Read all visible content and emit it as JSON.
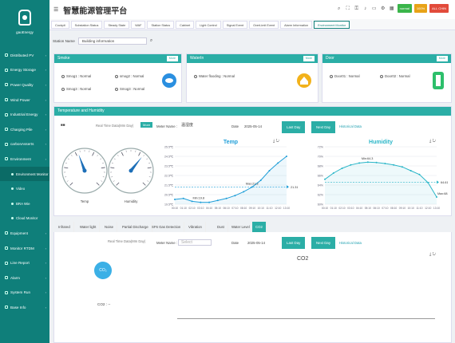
{
  "app": {
    "title": "智慧能源管理平台",
    "user": "gaoEnergy"
  },
  "sidebar": {
    "items": [
      {
        "label": "Distributed PV"
      },
      {
        "label": "Energy Storage"
      },
      {
        "label": "Power Quality"
      },
      {
        "label": "Wind Power"
      },
      {
        "label": "Industrial Energy"
      },
      {
        "label": "Charging Pile"
      },
      {
        "label": "carbonAsserts"
      },
      {
        "label": "Environment"
      },
      {
        "label": "Environment Monitor"
      },
      {
        "label": "Video"
      },
      {
        "label": "BRA Wie"
      },
      {
        "label": "Cloud Monitor"
      },
      {
        "label": "Equipment"
      },
      {
        "label": "Monitor RTDM"
      },
      {
        "label": "Line Report"
      },
      {
        "label": "Alarm"
      },
      {
        "label": "System Run"
      },
      {
        "label": "Base Info"
      }
    ]
  },
  "header": {
    "badges": [
      "normal",
      "100%",
      "ALL CHIN"
    ],
    "badge_colors": [
      "#3ab54a",
      "#e8a317",
      "#e24b3b"
    ]
  },
  "tabs": [
    "Cockpit",
    "Substation Status",
    "Steady State",
    "WAF",
    "Station Status",
    "Cabinet",
    "Light Control",
    "Signal Event",
    "OverLimit Event",
    "Alarm Information",
    "Environment Monitor"
  ],
  "filter": {
    "label": "Station Name",
    "value": "Building information"
  },
  "smoke": {
    "title": "Smoke",
    "more": "More",
    "items": [
      "Smog1 : Normal",
      "smog2 : Normal",
      "Smog3 : Normal",
      "Smog3 : Normal"
    ]
  },
  "waterin": {
    "title": "WaterIn",
    "more": "More",
    "items": [
      "Water flooding : Normal"
    ]
  },
  "door": {
    "title": "Door",
    "more": "More",
    "items": [
      "Door01 : Normal",
      "Door02 : Normal"
    ]
  },
  "th": {
    "title": "Temperature and Humidity",
    "tabs": [
      "Real Time Data(Mm Day)",
      "More"
    ],
    "meter_label": "Meter Name :",
    "meter_value": "温湿度",
    "date_label": "Date",
    "date": "2025-05-14",
    "last_day": "Last Day",
    "next_day": "Next Day",
    "hist": "Historical Data",
    "gauges": [
      {
        "label": "Temp",
        "value": 21.3,
        "max": 50
      },
      {
        "label": "Humidity",
        "value": 64.3,
        "max": 100
      }
    ]
  },
  "chart_data": [
    {
      "type": "line",
      "title": "Temp",
      "x": [
        "00:10",
        "01:10",
        "02:10",
        "03:10",
        "04:10",
        "05:10",
        "06:10",
        "07:10",
        "08:10",
        "09:10",
        "10:10",
        "11:10",
        "12:10",
        "13:10"
      ],
      "ylabels": [
        "25.5℃",
        "24.5℃",
        "23.5℃",
        "22.5℃",
        "21.5℃",
        "20.5℃",
        "19.5℃"
      ],
      "ylim": [
        19.5,
        25.5
      ],
      "values": [
        20.0,
        20.1,
        19.8,
        19.7,
        19.7,
        19.9,
        20.1,
        20.4,
        20.8,
        21.3,
        22.0,
        23.0,
        23.8,
        24.5
      ],
      "annotations": [
        "Min:19.8",
        "Max:21.3",
        "21.31"
      ],
      "color": "#1f9ed8"
    },
    {
      "type": "line",
      "title": "Humidity",
      "x": [
        "00:10",
        "01:10",
        "02:10",
        "03:10",
        "04:10",
        "05:10",
        "06:10",
        "07:10",
        "08:10",
        "09:10",
        "10:10",
        "11:10",
        "12:10",
        "13:10"
      ],
      "ylabels": [
        "72%",
        "70%",
        "68%",
        "66%",
        "64%",
        "62%",
        "60%"
      ],
      "ylim": [
        60,
        72
      ],
      "values": [
        65.2,
        66.5,
        67.5,
        68.2,
        68.6,
        68.8,
        68.7,
        68.5,
        68.2,
        67.8,
        67.0,
        66.2,
        64.5,
        61.5
      ],
      "annotations": [
        "Max:68.8",
        "Min:64.3",
        "64.61"
      ],
      "color": "#2bb6c8"
    }
  ],
  "bottom_tabs": [
    "Infrared",
    "Water light",
    "Noise",
    "Partial Discharge",
    "SF6 Gas Detection",
    "Vibration",
    "Dust",
    "Water Level",
    "CO2"
  ],
  "co2": {
    "realtime": "Real Time Data(Mm Day)",
    "meter_label": "Meter Name :",
    "meter_placeholder": "Select",
    "date_label": "Date",
    "date": "2025-05-14",
    "last_day": "Last Day",
    "next_day": "Next Day",
    "hist": "Historical Data",
    "chart_title": "CO2",
    "value_label": "CO2 : --"
  }
}
